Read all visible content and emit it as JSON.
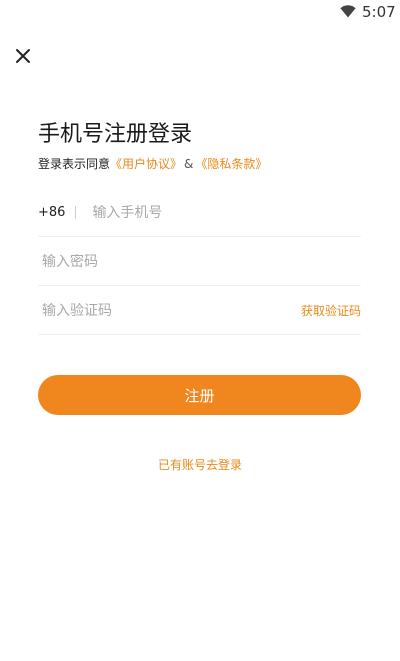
{
  "status_bar": {
    "time": "5:07",
    "wifi_icon": "wifi-icon"
  },
  "header": {
    "close_icon": "close-icon"
  },
  "title": "手机号注册登录",
  "agreement": {
    "prefix": "登录表示同意",
    "user_agreement": "《用户协议》",
    "separator": "&",
    "privacy_policy": "《隐私条款》"
  },
  "phone": {
    "country_code": "+86",
    "placeholder": "输入手机号",
    "value": ""
  },
  "password": {
    "placeholder": "输入密码",
    "value": ""
  },
  "verification": {
    "placeholder": "输入验证码",
    "value": "",
    "get_code_label": "获取验证码"
  },
  "register_label": "注册",
  "login_link": "已有账号去登录",
  "colors": {
    "accent": "#ef861e",
    "link": "#e8891a",
    "placeholder": "#a8a8a8",
    "divider": "#eeeeee"
  }
}
